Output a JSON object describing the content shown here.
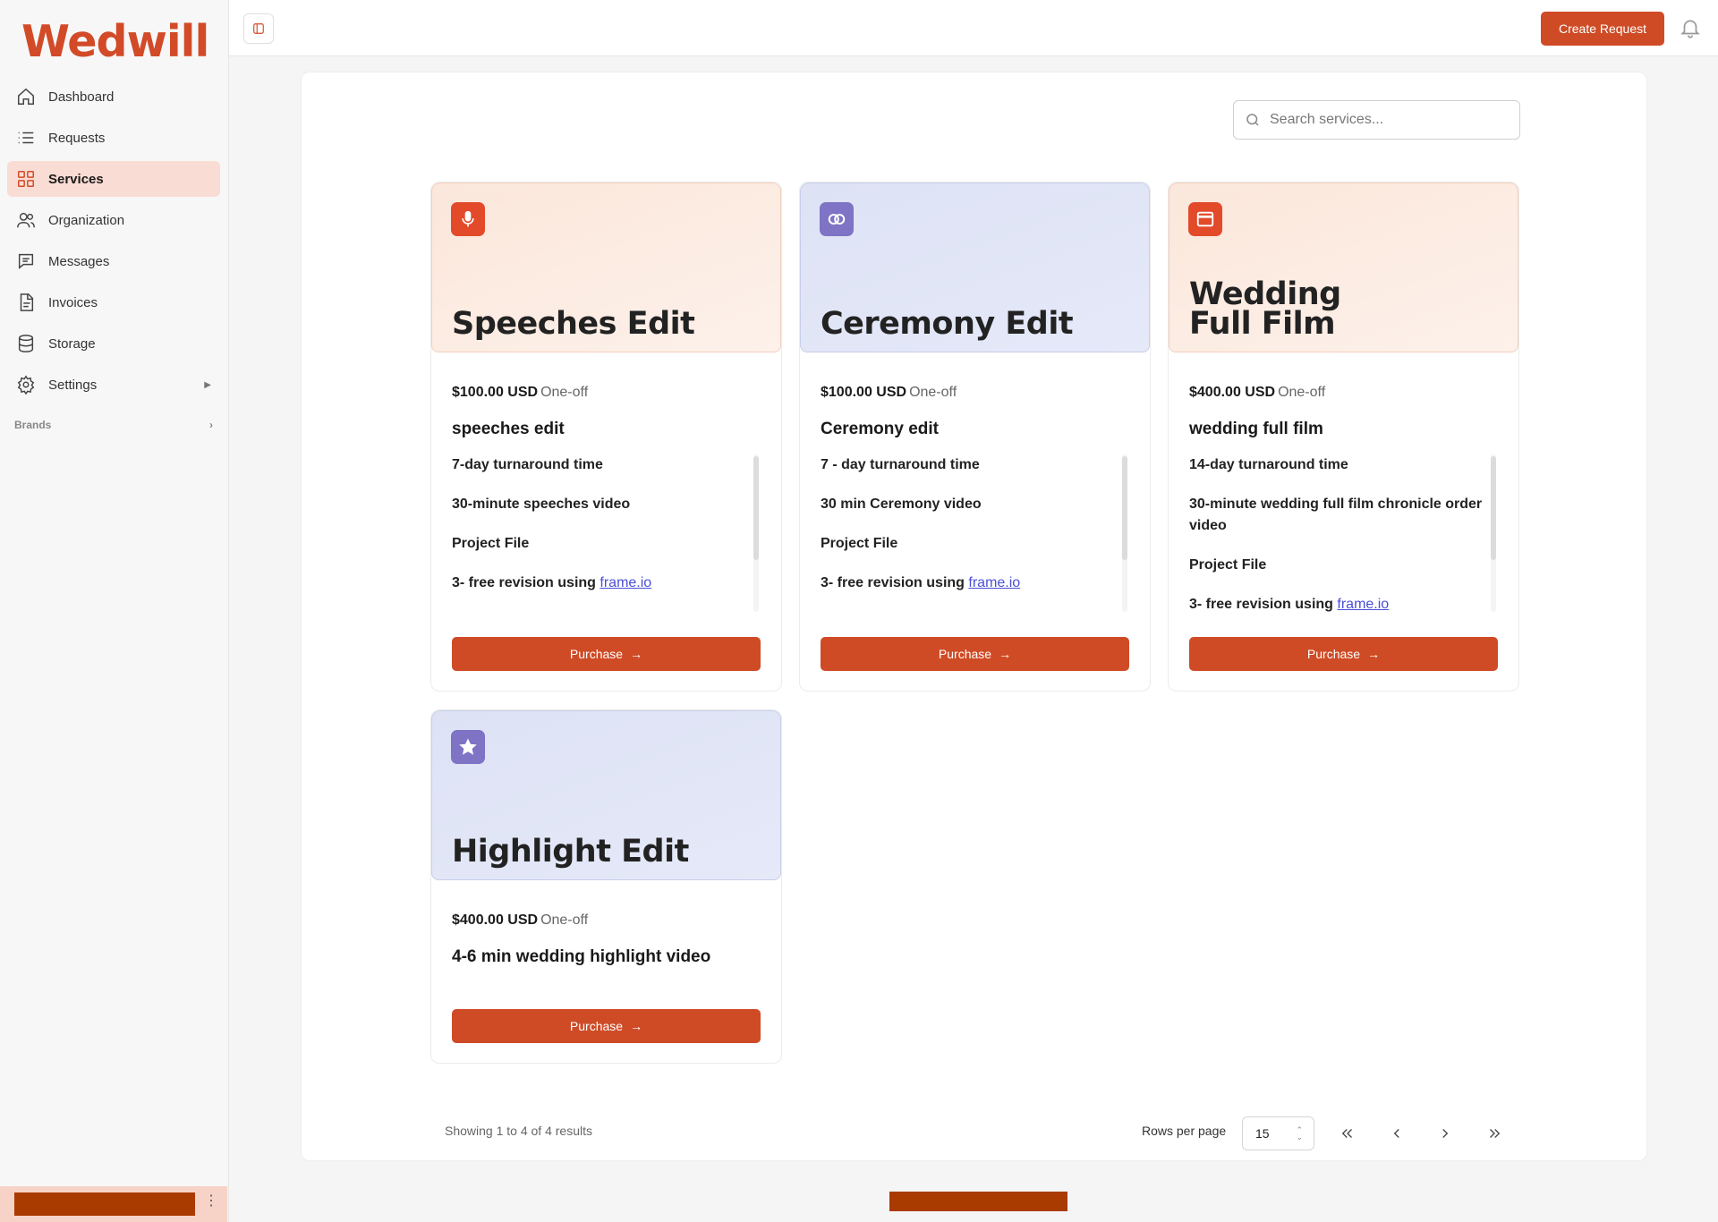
{
  "app": {
    "logo": "Wedwill"
  },
  "sidebar": {
    "items": [
      {
        "label": "Dashboard",
        "icon": "home-icon",
        "active": false
      },
      {
        "label": "Requests",
        "icon": "list-icon",
        "active": false
      },
      {
        "label": "Services",
        "icon": "grid-icon",
        "active": true
      },
      {
        "label": "Organization",
        "icon": "users-icon",
        "active": false
      },
      {
        "label": "Messages",
        "icon": "message-icon",
        "active": false
      },
      {
        "label": "Invoices",
        "icon": "file-icon",
        "active": false
      },
      {
        "label": "Storage",
        "icon": "database-icon",
        "active": false
      },
      {
        "label": "Settings",
        "icon": "gear-icon",
        "active": false
      }
    ],
    "brands_label": "Brands"
  },
  "header": {
    "create_label": "Create Request"
  },
  "search": {
    "placeholder": "Search services..."
  },
  "services": [
    {
      "title": "Speeches Edit",
      "theme": "peach",
      "icon": "microphone-icon",
      "price": "$100.00 USD",
      "kind": "One-off",
      "name": "speeches edit",
      "features": [
        "7-day turnaround time",
        "30-minute speeches video",
        "Project File",
        "3- free revision using"
      ],
      "link": "frame.io",
      "purchase": "Purchase"
    },
    {
      "title": "Ceremony Edit",
      "theme": "lavender",
      "icon": "rings-icon",
      "price": "$100.00 USD",
      "kind": "One-off",
      "name": "Ceremony edit",
      "features": [
        "7 - day turnaround time",
        "30 min Ceremony video",
        "Project File",
        "3- free revision using"
      ],
      "link": "frame.io",
      "purchase": "Purchase"
    },
    {
      "title_line1": "Wedding",
      "title_line2": "Full Film",
      "theme": "peach",
      "icon": "browser-window-icon",
      "price": "$400.00 USD",
      "kind": "One-off",
      "name": "wedding full film",
      "features": [
        "14-day turnaround time",
        "30-minute wedding full film chronicle order video",
        "Project File",
        "3- free revision using"
      ],
      "link": "frame.io",
      "purchase": "Purchase"
    },
    {
      "title": "Highlight Edit",
      "theme": "lavender",
      "icon": "star-icon",
      "price": "$400.00 USD",
      "kind": "One-off",
      "name": "4-6 min wedding highlight video",
      "purchase": "Purchase"
    }
  ],
  "pagination": {
    "showing": "Showing 1 to 4 of 4 results",
    "rows_label": "Rows per page",
    "rows_value": "15"
  },
  "colors": {
    "accent": "#cf4b26",
    "logo": "#d24a27",
    "active_nav": "#f9dcd3"
  }
}
